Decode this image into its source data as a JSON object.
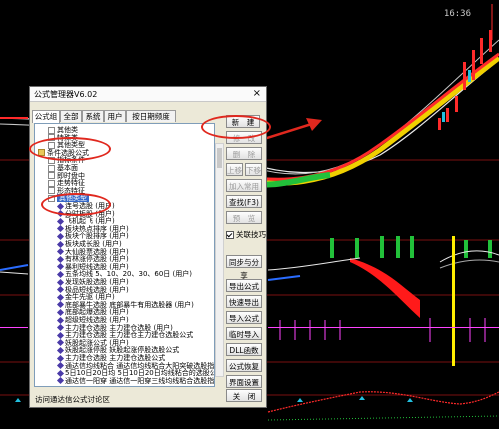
{
  "clock": "16:36",
  "dialog": {
    "title": "公式管理器V6.02",
    "close": "×",
    "tabs": [
      "公式组",
      "全部",
      "系统",
      "用户",
      "按日期频度"
    ],
    "tree": [
      {
        "level": 1,
        "kind": "plus",
        "label": "其他类"
      },
      {
        "level": 1,
        "kind": "plus",
        "label": "特殊类"
      },
      {
        "level": 1,
        "kind": "plus",
        "label": "其他类型"
      },
      {
        "level": 0,
        "kind": "folder",
        "label": "条件选股公式"
      },
      {
        "level": 1,
        "kind": "plus",
        "label": "指标条件"
      },
      {
        "level": 1,
        "kind": "plus",
        "label": "基本面"
      },
      {
        "level": 1,
        "kind": "plus",
        "label": "即时盘中"
      },
      {
        "level": 1,
        "kind": "plus",
        "label": "走势特征"
      },
      {
        "level": 1,
        "kind": "plus",
        "label": "形态特征"
      },
      {
        "level": 1,
        "kind": "open",
        "label": "其他类型",
        "selected": true
      },
      {
        "level": 2,
        "kind": "diamond",
        "label": "连号选股    (用户)"
      },
      {
        "level": 2,
        "kind": "diamond",
        "label": "分时板股    (用户)"
      },
      {
        "level": 2,
        "kind": "diamond",
        "label": "飞机起飞    (用户)"
      },
      {
        "level": 2,
        "kind": "diamond",
        "label": "板块热点排序    (用户)"
      },
      {
        "level": 2,
        "kind": "diamond",
        "label": "板块个股排序    (用户)"
      },
      {
        "level": 2,
        "kind": "diamond",
        "label": "板块成长股    (用户)"
      },
      {
        "level": 2,
        "kind": "diamond",
        "label": "大仙股票选股    (用户)"
      },
      {
        "level": 2,
        "kind": "diamond",
        "label": "有林涨停选股    (用户)"
      },
      {
        "level": 2,
        "kind": "diamond",
        "label": "暴利短线选股    (用户)"
      },
      {
        "level": 2,
        "kind": "diamond",
        "label": "五条均线    5、10、20、30、60日 (用户)"
      },
      {
        "level": 2,
        "kind": "diamond",
        "label": "发现妖股选股    (用户)"
      },
      {
        "level": 2,
        "kind": "diamond",
        "label": "极品短线选股    (用户)"
      },
      {
        "level": 2,
        "kind": "diamond",
        "label": "金牛先驱    (用户)"
      },
      {
        "level": 2,
        "kind": "diamond",
        "label": "底部暴牛选股    底部暴牛有用选股器 (用户)"
      },
      {
        "level": 2,
        "kind": "diamond",
        "label": "底部起爆选股    (用户)"
      },
      {
        "level": 2,
        "kind": "diamond",
        "label": "超级短线选股    (用户)"
      },
      {
        "level": 2,
        "kind": "diamond",
        "label": "主力建仓选股    主力建仓选股 (用户)"
      },
      {
        "level": 2,
        "kind": "diamond",
        "label": "主力建仓选股    主力建仓主力建仓选股公式"
      },
      {
        "level": 2,
        "kind": "diamond",
        "label": "妖股起涨公式    (用户)"
      },
      {
        "level": 2,
        "kind": "diamond",
        "label": "妖股起涨停股    妖股起涨停股选股公式"
      },
      {
        "level": 2,
        "kind": "diamond",
        "label": "主力建仓选股    主力建仓选股公式"
      },
      {
        "level": 2,
        "kind": "diamond",
        "label": "通达信均线粘合    通达信均线粘合大阳突破选股指标"
      },
      {
        "level": 2,
        "kind": "diamond",
        "label": "5日10日20日均    5日10日20日均线粘合的选股公式"
      },
      {
        "level": 2,
        "kind": "diamond",
        "label": "通达信一阳穿    通达信一阳穿三线均线粘合选股指标"
      }
    ],
    "buttons": [
      {
        "label": "新　建",
        "enabled": true
      },
      {
        "label": "修　改",
        "enabled": false
      },
      {
        "label": "删　除",
        "enabled": false
      },
      {
        "label": "上移",
        "enabled": false
      },
      {
        "label": "下移",
        "enabled": false
      },
      {
        "label": "加入常用",
        "enabled": false
      },
      {
        "label": "查找(F3)",
        "enabled": true
      },
      {
        "label": "预　览",
        "enabled": false
      },
      {
        "label": "关联技巧",
        "enabled": true
      },
      {
        "label": "同步与分享",
        "enabled": true
      },
      {
        "label": "导出公式",
        "enabled": true
      },
      {
        "label": "快速导出",
        "enabled": true
      },
      {
        "label": "导入公式",
        "enabled": true
      },
      {
        "label": "临时导入",
        "enabled": true
      },
      {
        "label": "DLL函数",
        "enabled": true
      },
      {
        "label": "公式恢复",
        "enabled": true
      },
      {
        "label": "界面设置",
        "enabled": true
      },
      {
        "label": "关　闭",
        "enabled": true
      }
    ],
    "footer_link": "访问通达信公式讨论区"
  },
  "colors": {
    "annotation": "#e0281e",
    "selection": "#3568c8",
    "chart_bg": "#000000"
  }
}
